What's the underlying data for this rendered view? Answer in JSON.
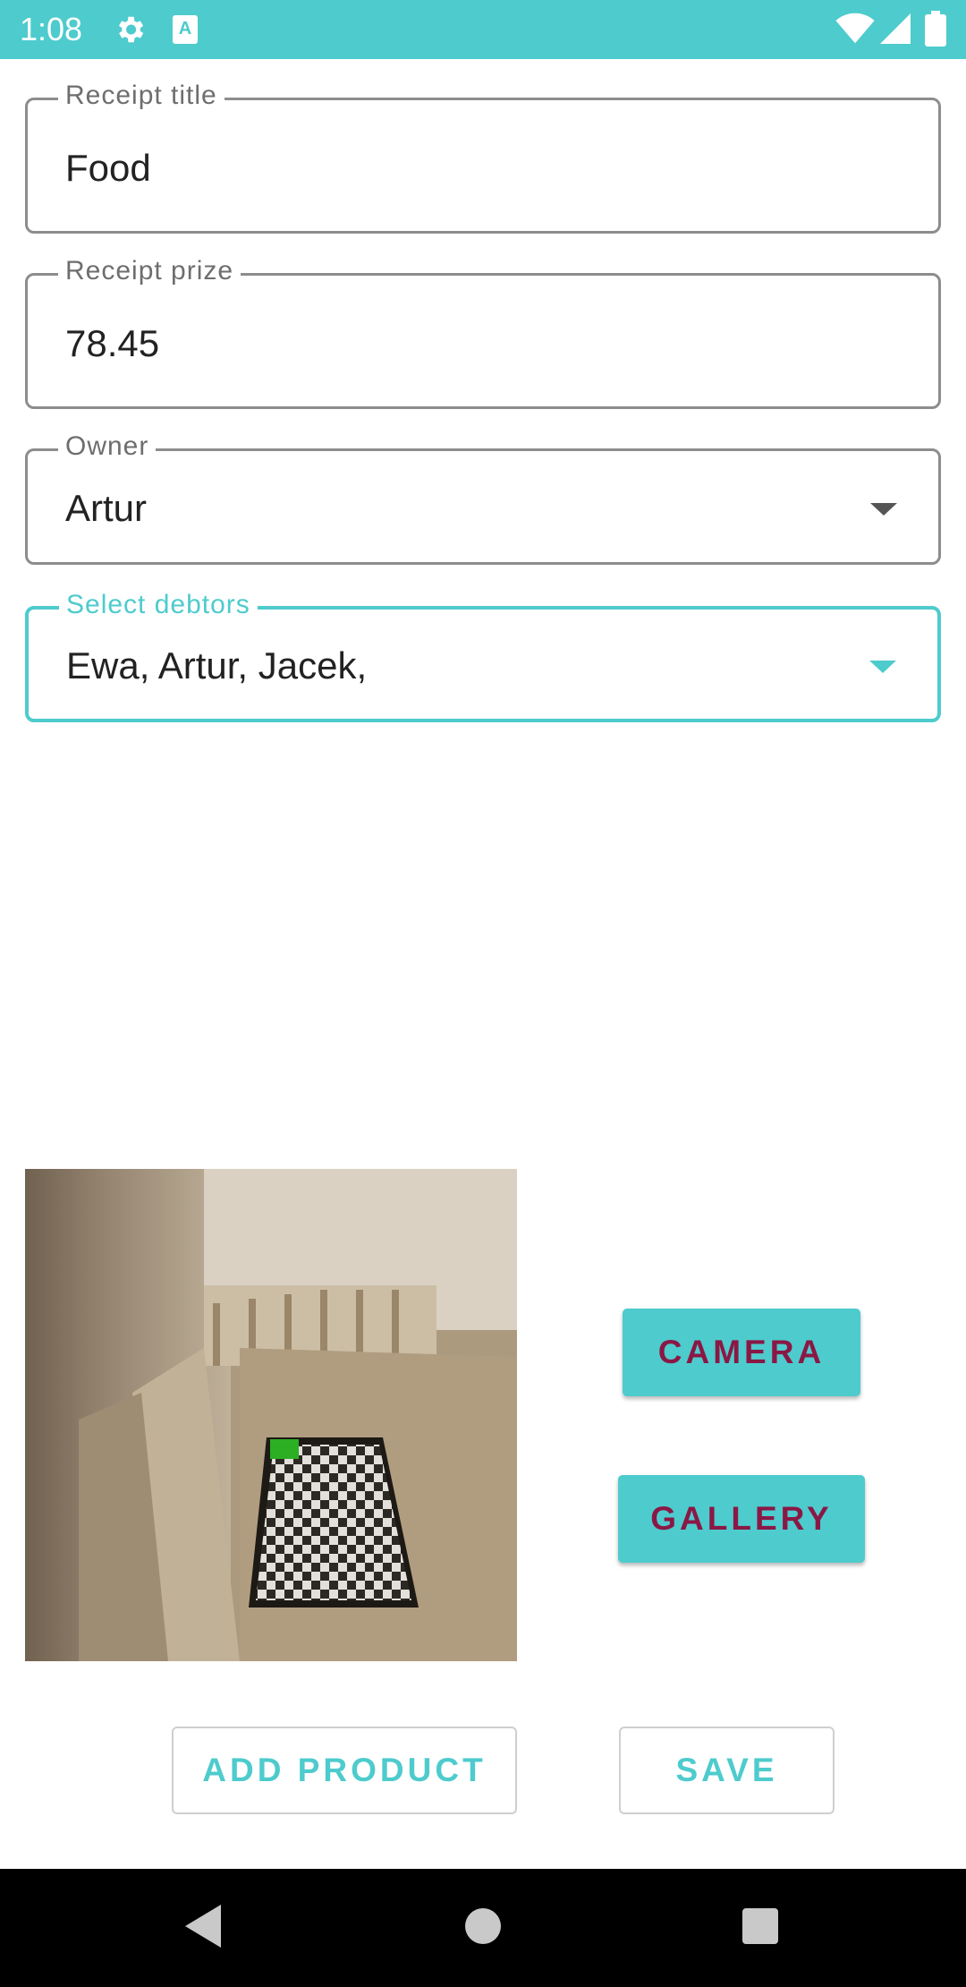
{
  "status_bar": {
    "time": "1:08",
    "background": "#4ecbcd"
  },
  "form": {
    "title_field": {
      "label": "Receipt title",
      "value": "Food"
    },
    "price_field": {
      "label": "Receipt prize",
      "value": "78.45"
    },
    "owner_field": {
      "label": "Owner",
      "value": "Artur"
    },
    "debtors_field": {
      "label": "Select debtors",
      "value": "Ewa, Artur, Jacek,"
    }
  },
  "buttons": {
    "camera": "CAMERA",
    "gallery": "GALLERY",
    "add_product": "ADD PRODUCT",
    "save": "SAVE"
  },
  "colors": {
    "accent": "#4ecbcd",
    "button_text": "#8a1845"
  },
  "icons": {
    "status": [
      "gear-icon",
      "a-notification-icon",
      "wifi-icon",
      "signal-icon",
      "battery-icon"
    ],
    "nav": [
      "back-icon",
      "home-icon",
      "recents-icon"
    ]
  }
}
